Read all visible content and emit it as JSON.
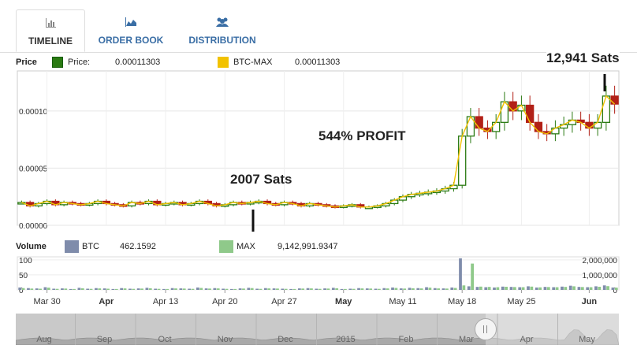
{
  "tabs": [
    {
      "label": "TIMELINE",
      "icon": "bar-chart-icon",
      "active": true
    },
    {
      "label": "ORDER BOOK",
      "icon": "area-chart-icon",
      "active": false
    },
    {
      "label": "DISTRIBUTION",
      "icon": "users-icon",
      "active": false
    }
  ],
  "price_legend": {
    "title": "Price",
    "series1_name": "Price:",
    "series1_value": "0.00011303",
    "series2_name": "BTC-MAX",
    "series2_value": "0.00011303"
  },
  "volume_legend": {
    "title": "Volume",
    "series1_name": "BTC",
    "series1_value": "462.1592",
    "series2_name": "MAX",
    "series2_value": "9,142,991.9347"
  },
  "annotations": {
    "sats_low": "2007 Sats",
    "profit": "544% PROFIT",
    "sats_high": "12,941 Sats"
  },
  "colors": {
    "up": "#2a7a12",
    "down": "#b22017",
    "line": "#f2c200",
    "btc_volume": "#7f8cab",
    "max_volume": "#8fc98a",
    "navigator": "#c9c9c9"
  },
  "chart_data": [
    {
      "type": "line",
      "title": "Price",
      "yticks": [
        "0.00000",
        "0.00005",
        "0.00010"
      ],
      "ylim": [
        0,
        0.000135
      ],
      "xticks": [
        "Mar 30",
        "Apr",
        "Apr 13",
        "Apr 20",
        "Apr 27",
        "May",
        "May 11",
        "May 18",
        "May 25",
        "Jun"
      ],
      "series": [
        {
          "name": "BTC-MAX",
          "values": [
            2e-05,
            1.7e-05,
            1.9e-05,
            2.1e-05,
            1.8e-05,
            2e-05,
            1.9e-05,
            1.8e-05,
            1.9e-05,
            2.1e-05,
            1.9e-05,
            1.8e-05,
            1.7e-05,
            2e-05,
            1.9e-05,
            2.1e-05,
            1.8e-05,
            1.9e-05,
            2e-05,
            1.8e-05,
            1.9e-05,
            2.1e-05,
            1.9e-05,
            1.7e-05,
            1.8e-05,
            2e-05,
            1.9e-05,
            2e-05,
            2.1e-05,
            1.9e-05,
            1.8e-05,
            2e-05,
            1.9e-05,
            1.7e-05,
            1.9e-05,
            1.8e-05,
            1.7e-05,
            1.6e-05,
            1.7e-05,
            1.8e-05,
            1.6e-05,
            1.6e-05,
            1.7e-05,
            1.9e-05,
            2.2e-05,
            2.5e-05,
            2.7e-05,
            2.8e-05,
            2.9e-05,
            3e-05,
            3.2e-05,
            3.5e-05,
            7.8e-05,
            9.5e-05,
            8.5e-05,
            8.2e-05,
            9e-05,
            0.000108,
            0.0001,
            0.000105,
            9e-05,
            8.2e-05,
            8e-05,
            8.5e-05,
            8.8e-05,
            9.2e-05,
            9e-05,
            8.5e-05,
            9e-05,
            0.000113,
            0.000106
          ]
        }
      ]
    },
    {
      "type": "bar",
      "title": "Volume",
      "yticks_left": [
        "100",
        "50",
        "0"
      ],
      "yticks_right": [
        "2,000,000",
        "1,000,000",
        "0"
      ],
      "series": [
        {
          "name": "BTC",
          "values": [
            8,
            6,
            5,
            9,
            4,
            5,
            3,
            7,
            4,
            6,
            5,
            3,
            6,
            4,
            5,
            7,
            4,
            3,
            6,
            5,
            4,
            8,
            5,
            6,
            4,
            3,
            5,
            7,
            4,
            6,
            5,
            4,
            3,
            5,
            6,
            4,
            5,
            7,
            3,
            4,
            6,
            5,
            4,
            6,
            8,
            5,
            7,
            6,
            9,
            6,
            5,
            8,
            105,
            12,
            10,
            9,
            8,
            11,
            10,
            9,
            12,
            8,
            10,
            9,
            11,
            14,
            10,
            9,
            12,
            15,
            8
          ]
        },
        {
          "name": "MAX",
          "values": [
            120000,
            90000,
            80000,
            150000,
            70000,
            90000,
            60000,
            110000,
            70000,
            100000,
            80000,
            60000,
            100000,
            70000,
            90000,
            110000,
            70000,
            60000,
            100000,
            90000,
            70000,
            130000,
            90000,
            100000,
            70000,
            60000,
            90000,
            120000,
            70000,
            100000,
            90000,
            70000,
            60000,
            90000,
            100000,
            70000,
            90000,
            110000,
            60000,
            70000,
            100000,
            90000,
            70000,
            100000,
            130000,
            90000,
            110000,
            100000,
            150000,
            100000,
            90000,
            130000,
            300000,
            1750000,
            220000,
            200000,
            180000,
            210000,
            190000,
            180000,
            220000,
            170000,
            190000,
            180000,
            200000,
            240000,
            190000,
            180000,
            210000,
            250000,
            150000
          ]
        }
      ]
    }
  ],
  "navigator": {
    "labels": [
      "Aug",
      "Sep",
      "Oct",
      "Nov",
      "Dec",
      "2015",
      "Feb",
      "Mar",
      "Apr",
      "May"
    ]
  }
}
